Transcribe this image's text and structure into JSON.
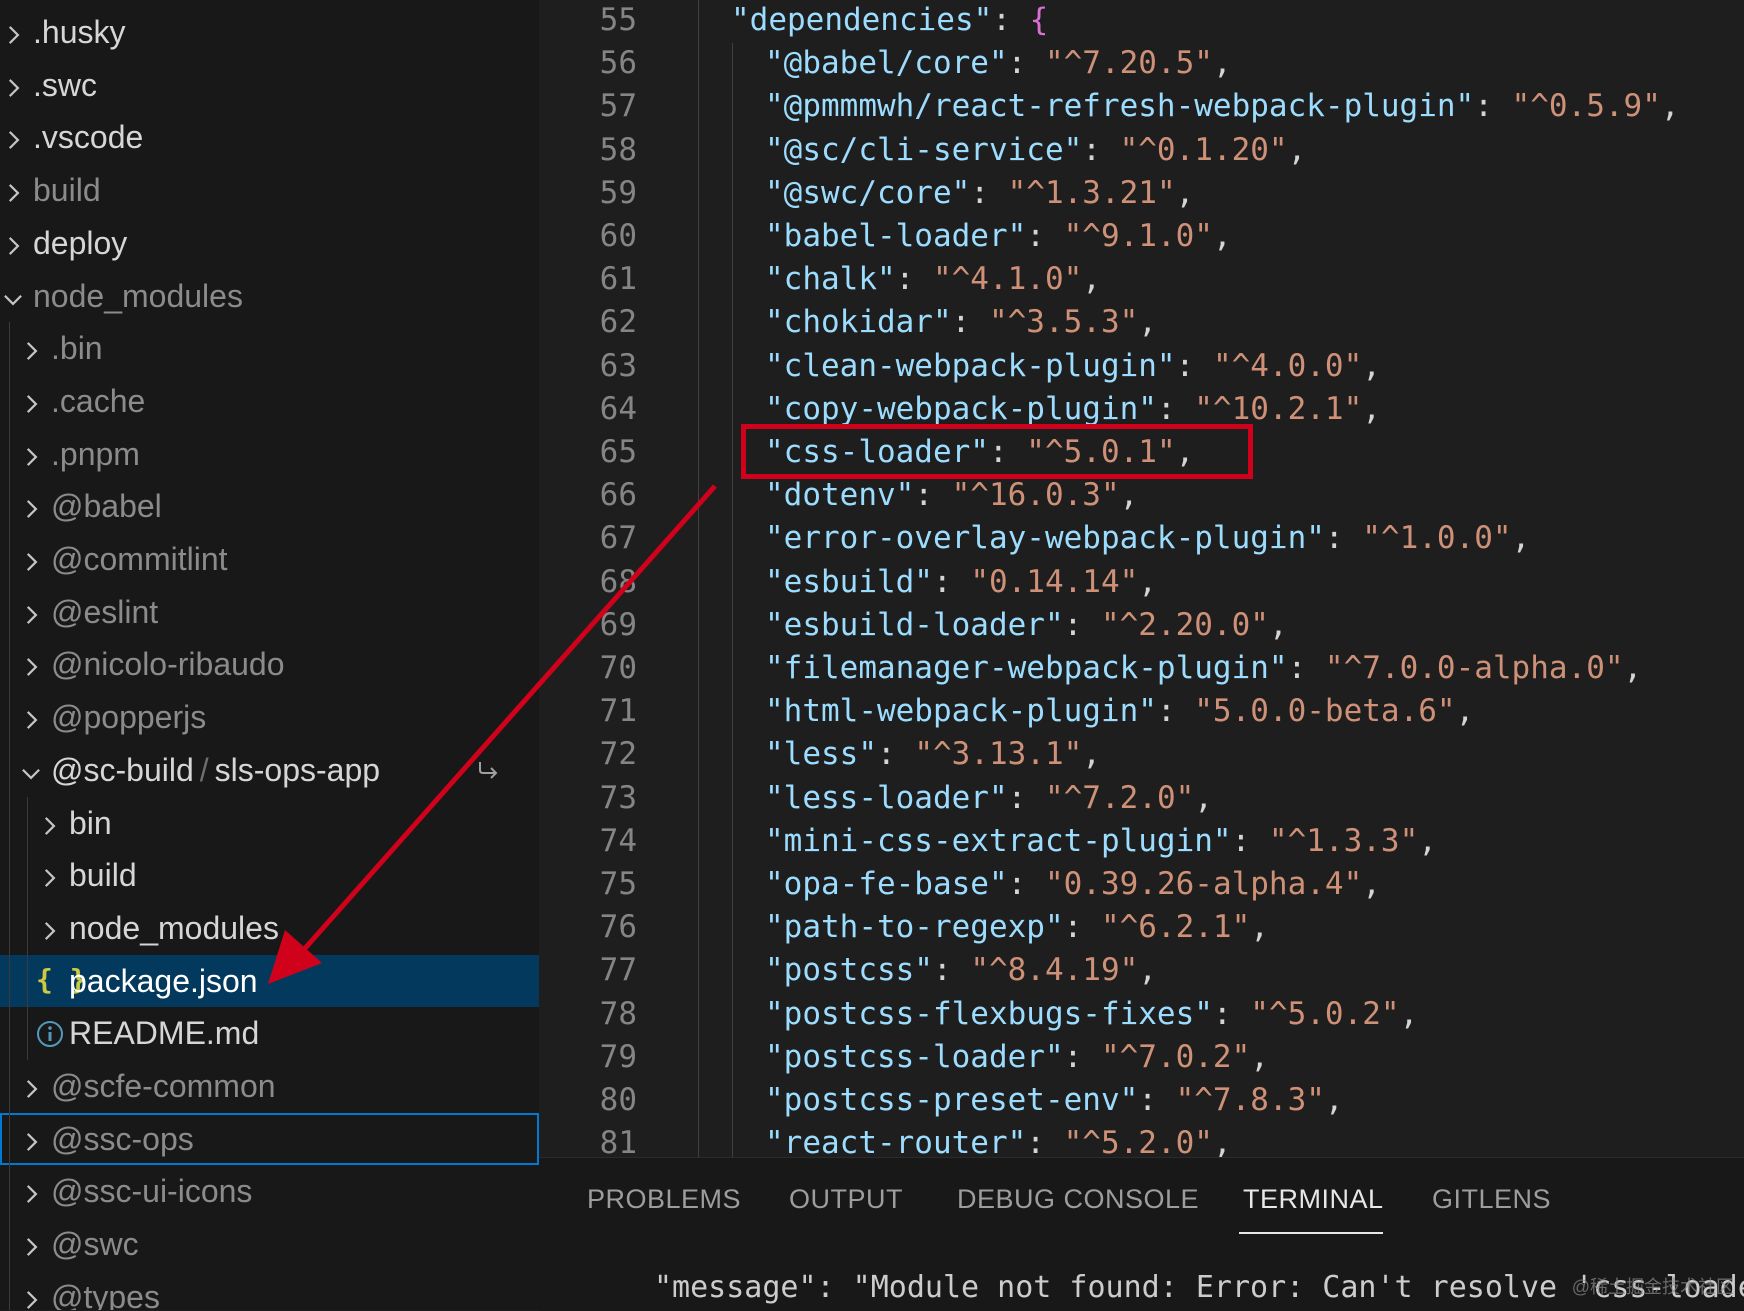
{
  "explorer": {
    "items": [
      {
        "label": ".husky",
        "expanded": false
      },
      {
        "label": ".swc",
        "expanded": false
      },
      {
        "label": ".vscode",
        "expanded": false
      },
      {
        "label": "build",
        "expanded": false
      },
      {
        "label": "deploy",
        "expanded": false
      },
      {
        "label": "node_modules",
        "expanded": true
      },
      {
        "label": ".bin",
        "expanded": false
      },
      {
        "label": ".cache",
        "expanded": false
      },
      {
        "label": ".pnpm",
        "expanded": false
      },
      {
        "label": "@babel",
        "expanded": false
      },
      {
        "label": "@commitlint",
        "expanded": false
      },
      {
        "label": "@eslint",
        "expanded": false
      },
      {
        "label": "@nicolo-ribaudo",
        "expanded": false
      },
      {
        "label": "@popperjs",
        "expanded": false
      },
      {
        "label_part1": "@sc-build",
        "separator": "/",
        "label_part2": "sls-ops-app",
        "expanded": true,
        "icon": "symlink-arrow-icon"
      },
      {
        "label": "bin",
        "expanded": false
      },
      {
        "label": "build",
        "expanded": false
      },
      {
        "label": "node_modules",
        "expanded": false
      },
      {
        "label": "package.json",
        "icon": "json-braces-icon",
        "selected": true,
        "icon_text": "{ }"
      },
      {
        "label": "README.md",
        "icon": "info-icon"
      },
      {
        "label": "@scfe-common",
        "expanded": false
      },
      {
        "label": "@ssc-ops",
        "expanded": false,
        "focused": true
      },
      {
        "label": "@ssc-ui-icons",
        "expanded": false
      },
      {
        "label": "@swc",
        "expanded": false
      },
      {
        "label": "@types",
        "expanded": false
      }
    ]
  },
  "editor": {
    "lines": [
      {
        "n": "55",
        "key": "\"dependencies\"",
        "brace": "{"
      },
      {
        "n": "56",
        "key": "\"@babel/core\"",
        "val": "\"^7.20.5\""
      },
      {
        "n": "57",
        "key": "\"@pmmmwh/react-refresh-webpack-plugin\"",
        "val": "\"^0.5.9\""
      },
      {
        "n": "58",
        "key": "\"@sc/cli-service\"",
        "val": "\"^0.1.20\""
      },
      {
        "n": "59",
        "key": "\"@swc/core\"",
        "val": "\"^1.3.21\""
      },
      {
        "n": "60",
        "key": "\"babel-loader\"",
        "val": "\"^9.1.0\""
      },
      {
        "n": "61",
        "key": "\"chalk\"",
        "val": "\"^4.1.0\""
      },
      {
        "n": "62",
        "key": "\"chokidar\"",
        "val": "\"^3.5.3\""
      },
      {
        "n": "63",
        "key": "\"clean-webpack-plugin\"",
        "val": "\"^4.0.0\""
      },
      {
        "n": "64",
        "key": "\"copy-webpack-plugin\"",
        "val": "\"^10.2.1\""
      },
      {
        "n": "65",
        "key": "\"css-loader\"",
        "val": "\"^5.0.1\""
      },
      {
        "n": "66",
        "key": "\"dotenv\"",
        "val": "\"^16.0.3\""
      },
      {
        "n": "67",
        "key": "\"error-overlay-webpack-plugin\"",
        "val": "\"^1.0.0\""
      },
      {
        "n": "68",
        "key": "\"esbuild\"",
        "val": "\"0.14.14\""
      },
      {
        "n": "69",
        "key": "\"esbuild-loader\"",
        "val": "\"^2.20.0\""
      },
      {
        "n": "70",
        "key": "\"filemanager-webpack-plugin\"",
        "val": "\"^7.0.0-alpha.0\""
      },
      {
        "n": "71",
        "key": "\"html-webpack-plugin\"",
        "val": "\"5.0.0-beta.6\""
      },
      {
        "n": "72",
        "key": "\"less\"",
        "val": "\"^3.13.1\""
      },
      {
        "n": "73",
        "key": "\"less-loader\"",
        "val": "\"^7.2.0\""
      },
      {
        "n": "74",
        "key": "\"mini-css-extract-plugin\"",
        "val": "\"^1.3.3\""
      },
      {
        "n": "75",
        "key": "\"opa-fe-base\"",
        "val": "\"0.39.26-alpha.4\""
      },
      {
        "n": "76",
        "key": "\"path-to-regexp\"",
        "val": "\"^6.2.1\""
      },
      {
        "n": "77",
        "key": "\"postcss\"",
        "val": "\"^8.4.19\""
      },
      {
        "n": "78",
        "key": "\"postcss-flexbugs-fixes\"",
        "val": "\"^5.0.2\""
      },
      {
        "n": "79",
        "key": "\"postcss-loader\"",
        "val": "\"^7.0.2\""
      },
      {
        "n": "80",
        "key": "\"postcss-preset-env\"",
        "val": "\"^7.8.3\""
      },
      {
        "n": "81",
        "key": "\"react-router\"",
        "val": "\"^5.2.0\""
      }
    ],
    "colon": ": ",
    "comma": ","
  },
  "panel": {
    "tabs": [
      "PROBLEMS",
      "OUTPUT",
      "DEBUG CONSOLE",
      "TERMINAL",
      "GITLENS"
    ],
    "active_tab": "TERMINAL",
    "terminal_text": "\"message\": \"Module not found: Error: Can't resolve 'css-loader'",
    "watermark": "@稀土掘金技术社区"
  },
  "annotation": {
    "color": "#d0021b",
    "highlighted_line": "65",
    "arrow_target": "package.json"
  }
}
